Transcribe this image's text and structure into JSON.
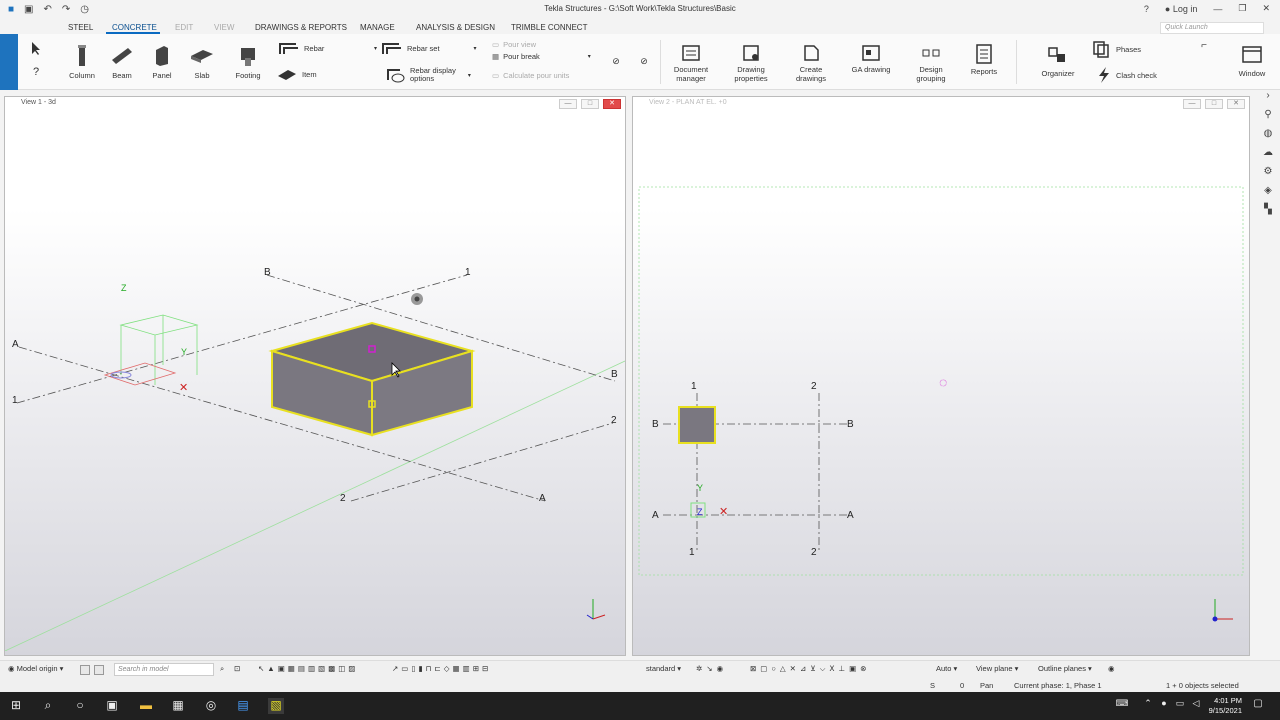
{
  "app": {
    "title": "Tekla Structures - G:\\Soft Work\\Tekla Structures\\Basic",
    "login": "Log in",
    "quick_launch_placeholder": "Quick Launch"
  },
  "menu": {
    "steel": "STEEL",
    "concrete": "CONCRETE",
    "edit": "EDIT",
    "view": "VIEW",
    "drawings": "DRAWINGS & REPORTS",
    "manage": "MANAGE",
    "analysis": "ANALYSIS & DESIGN",
    "trimble": "TRIMBLE CONNECT"
  },
  "ribbon": {
    "column": "Column",
    "beam": "Beam",
    "panel": "Panel",
    "slab": "Slab",
    "footing": "Footing",
    "rebar": "Rebar",
    "item": "Item",
    "rebar_set": "Rebar set",
    "rebar_display_1": "Rebar display",
    "rebar_display_2": "options",
    "pour_view": "Pour view",
    "pour_break": "Pour break",
    "calc_pour": "Calculate pour units",
    "doc_manager_1": "Document",
    "doc_manager_2": "manager",
    "drawing_props_1": "Drawing",
    "drawing_props_2": "properties",
    "create_drawings_1": "Create",
    "create_drawings_2": "drawings",
    "ga_drawing": "GA drawing",
    "design_grouping_1": "Design",
    "design_grouping_2": "grouping",
    "reports": "Reports",
    "organizer": "Organizer",
    "phases": "Phases",
    "clash_check": "Clash check",
    "window": "Window"
  },
  "view1": {
    "title": "View 1 - 3d",
    "grid": {
      "b_top": "B",
      "one_top": "1",
      "a_left": "A",
      "one_left": "1",
      "b_right": "B",
      "two_right": "2",
      "two_bottom": "2",
      "a_bottom": "A"
    },
    "axes": {
      "z": "Z",
      "y": "Y"
    }
  },
  "view2": {
    "title": "View 2 - PLAN AT EL. +0",
    "grid": {
      "one_top": "1",
      "two_top": "2",
      "b_left": "B",
      "b_right": "B",
      "a_left": "A",
      "a_right": "A",
      "one_bottom": "1",
      "two_bottom": "2"
    },
    "axes": {
      "y": "Y",
      "z": "Z"
    }
  },
  "statusbar": {
    "model_origin": "Model origin",
    "search_placeholder": "Search in model",
    "standard": "standard",
    "auto": "Auto",
    "view_plane": "View plane",
    "outline_planes": "Outline planes"
  },
  "statusline": {
    "s": "S",
    "zero": "0",
    "pan": "Pan",
    "phase": "Current phase: 1, Phase 1",
    "selected": "1 + 0 objects selected"
  },
  "taskbar": {
    "time": "4:01 PM",
    "date": "9/15/2021"
  },
  "colors": {
    "accent": "#0a6ac1",
    "selection": "#e8e020",
    "concrete": "#7a7780",
    "grid": "#555555",
    "guide": "#7fe07f"
  }
}
